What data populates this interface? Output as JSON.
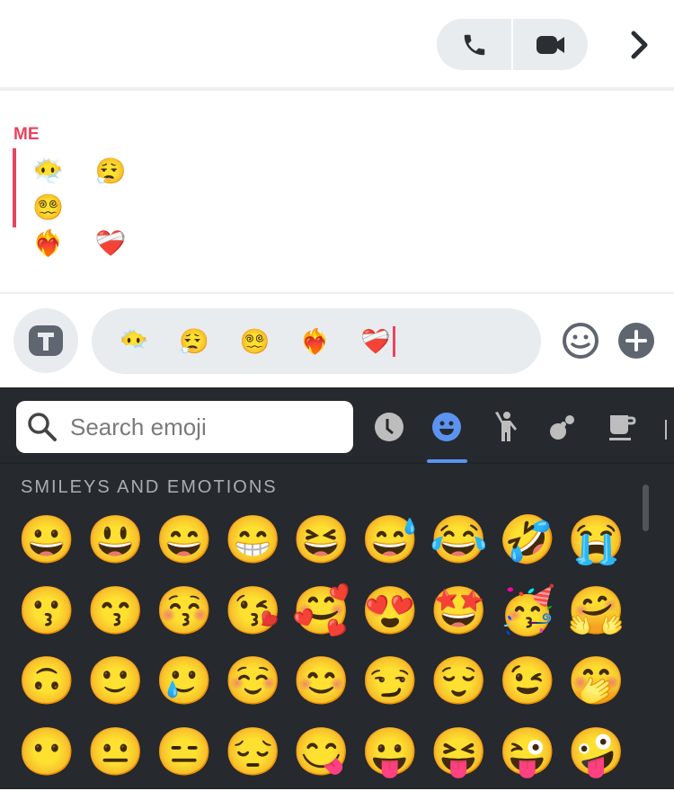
{
  "header": {
    "call_icon": "phone-icon",
    "video_icon": "video-camera-icon",
    "next_icon": "chevron-right-icon"
  },
  "message": {
    "sender": "ME",
    "text": "😶‍🌫️ 😮‍💨 😵‍💫\n❤️‍🔥 ❤️‍🩹"
  },
  "composer": {
    "value": "😶‍🌫️ 😮‍💨 😵‍💫  ❤️‍🔥 ❤️‍🩹",
    "format_icon": "text-format-icon",
    "emoji_icon": "emoji-icon",
    "add_icon": "plus-icon"
  },
  "keyboard": {
    "search_placeholder": "Search emoji",
    "categories": [
      "recent",
      "smileys",
      "people",
      "animals-nature",
      "food-drink"
    ],
    "active_category": "smileys",
    "accent_color": "#5b93f0",
    "section_title": "SMILEYS AND EMOTIONS",
    "emojis": [
      "😀",
      "😃",
      "😄",
      "😁",
      "😆",
      "😅",
      "😂",
      "🤣",
      "😭",
      "😗",
      "😙",
      "😚",
      "😘",
      "🥰",
      "😍",
      "🤩",
      "🥳",
      "🤗",
      "🙃",
      "🙂",
      "🥲",
      "☺️",
      "😊",
      "😏",
      "😌",
      "😉",
      "🤭",
      "😶",
      "😐",
      "😑",
      "😔",
      "😋",
      "😛",
      "😝",
      "😜",
      "🤪"
    ]
  }
}
